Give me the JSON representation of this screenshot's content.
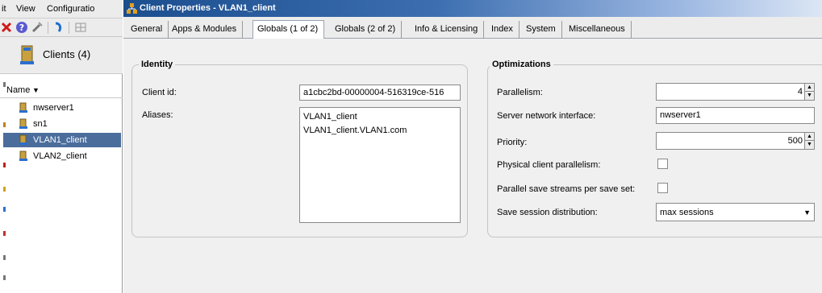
{
  "menubar": {
    "items": [
      "it",
      "View",
      "Configuratio"
    ]
  },
  "toolbar": {
    "icons": [
      "delete-icon",
      "help-icon",
      "wizard-icon",
      "refresh-icon",
      "grid-icon"
    ]
  },
  "tree": {
    "header": "Clients (4)",
    "column_header": "Name",
    "items": [
      {
        "label": "nwserver1",
        "selected": false
      },
      {
        "label": "sn1",
        "selected": false
      },
      {
        "label": "VLAN1_client",
        "selected": true
      },
      {
        "label": "VLAN2_client",
        "selected": false
      }
    ]
  },
  "window": {
    "title": "Client Properties - VLAN1_client"
  },
  "tabs": [
    {
      "label": "General",
      "active": false
    },
    {
      "label": "Apps & Modules",
      "active": false
    },
    {
      "label": "Globals (1 of 2)",
      "active": true
    },
    {
      "label": "Globals (2 of 2)",
      "active": false
    },
    {
      "label": "Info & Licensing",
      "active": false
    },
    {
      "label": "Index",
      "active": false
    },
    {
      "label": "System",
      "active": false
    },
    {
      "label": "Miscellaneous",
      "active": false
    }
  ],
  "identity": {
    "title": "Identity",
    "client_id_label": "Client id:",
    "client_id_value": "a1cbc2bd-00000004-516319ce-516",
    "aliases_label": "Aliases:",
    "aliases": [
      "VLAN1_client",
      "VLAN1_client.VLAN1.com"
    ]
  },
  "optimizations": {
    "title": "Optimizations",
    "parallelism_label": "Parallelism:",
    "parallelism_value": "4",
    "server_nic_label": "Server network interface:",
    "server_nic_value": "nwserver1",
    "priority_label": "Priority:",
    "priority_value": "500",
    "physical_parallelism_label": "Physical client parallelism:",
    "physical_parallelism_checked": false,
    "parallel_streams_label": "Parallel save streams per save set:",
    "parallel_streams_checked": false,
    "session_dist_label": "Save session distribution:",
    "session_dist_value": "max sessions"
  },
  "colors": {
    "selection": "#4a6d9c",
    "titlebar_start": "#1b4e8e",
    "titlebar_end": "#dce6f5"
  }
}
